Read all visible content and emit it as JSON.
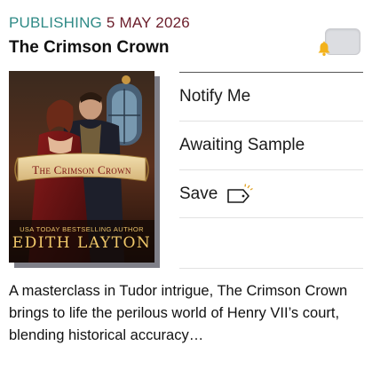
{
  "header": {
    "publishing_label": "PUBLISHING",
    "publishing_date": "5 MAY 2026",
    "title": "The Crimson Crown"
  },
  "cover": {
    "title": "The Crimson Crown",
    "tagline": "USA TODAY BESTSELLING AUTHOR",
    "author": "EDITH LAYTON"
  },
  "actions": {
    "notify": "Notify Me",
    "awaiting": "Awaiting Sample",
    "save": "Save"
  },
  "description": "A masterclass in Tudor intrigue, The Crimson Crown brings to life the perilous world of Henry VII’s court, blending historical accuracy…",
  "icons": {
    "notify_toggle": "bell-icon",
    "save": "tag-icon"
  },
  "colors": {
    "publishing_label": "#2f8a86",
    "publishing_date": "#6b1d2a",
    "bell": "#f3b21b"
  }
}
